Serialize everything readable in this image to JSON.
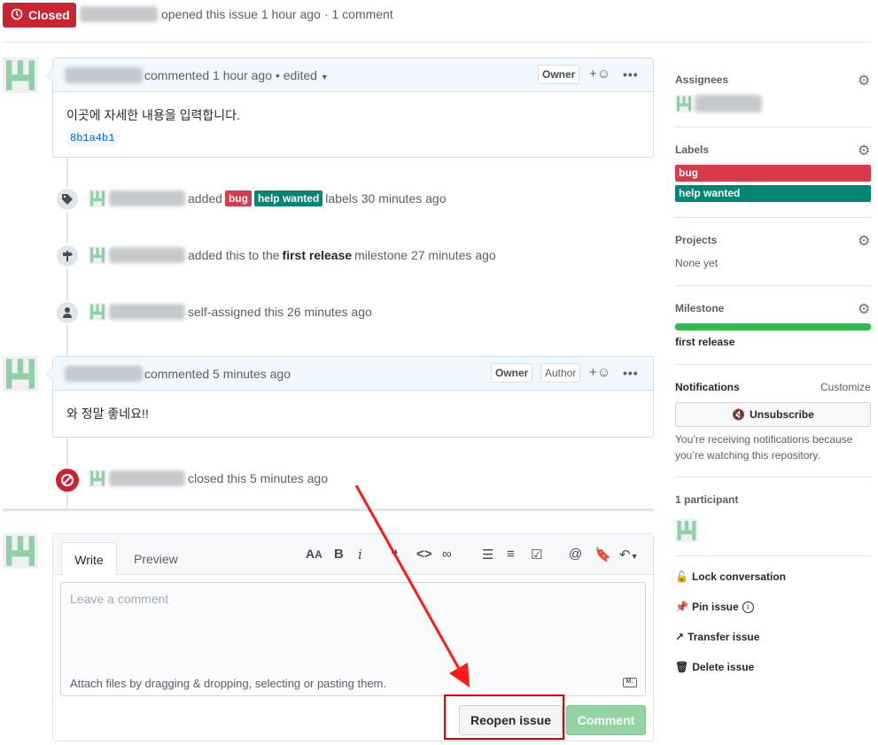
{
  "header": {
    "state": "Closed",
    "opened_text": "opened this issue 1 hour ago",
    "separator": "·",
    "comments_count": "1 comment"
  },
  "comments": [
    {
      "meta": "commented 1 hour ago",
      "edited": "• edited",
      "roles": [
        "Owner"
      ],
      "reaction_plus": "+",
      "more": "•••",
      "body": "이곳에 자세한 내용을 입력합니다.",
      "sha": "8b1a4b1"
    },
    {
      "meta": "commented 5 minutes ago",
      "roles": [
        "Owner",
        "Author"
      ],
      "reaction_plus": "+",
      "more": "•••",
      "body": "와 정말 좋네요!!"
    }
  ],
  "timeline": {
    "labels_event": {
      "added": "added",
      "label_bug": "bug",
      "label_help": "help wanted",
      "suffix": "labels 30 minutes ago"
    },
    "milestone_event": {
      "prefix": "added this to the",
      "milestone": "first release",
      "suffix": "milestone 27 minutes ago"
    },
    "assign_event": {
      "text": "self-assigned this 26 minutes ago"
    },
    "closed_event": {
      "text": "closed this 5 minutes ago"
    }
  },
  "editor": {
    "tab_write": "Write",
    "tab_preview": "Preview",
    "placeholder": "Leave a comment",
    "attach_hint": "Attach files by dragging & dropping, selecting or pasting them.",
    "reopen_button": "Reopen issue",
    "comment_button": "Comment",
    "toolbar_icons": [
      "text-size-icon",
      "bold-icon",
      "italic-icon",
      "quote-icon",
      "code-icon",
      "link-icon",
      "bulleted-list-icon",
      "numbered-list-icon",
      "task-list-icon",
      "mention-icon",
      "saved-reply-icon",
      "reply-icon"
    ]
  },
  "sidebar": {
    "assignees_title": "Assignees",
    "labels_title": "Labels",
    "labels": [
      {
        "name": "bug",
        "color": "#d73a4a"
      },
      {
        "name": "help wanted",
        "color": "#008672"
      }
    ],
    "projects_title": "Projects",
    "projects_value": "None yet",
    "milestone_title": "Milestone",
    "milestone_value": "first release",
    "milestone_progress": 1.0,
    "notifications_title": "Notifications",
    "customize": "Customize",
    "unsubscribe": "Unsubscribe",
    "notify_reason": "You’re receiving notifications because you’re watching this repository.",
    "participants": "1 participant",
    "actions": {
      "lock": "Lock conversation",
      "pin": "Pin issue",
      "transfer": "Transfer issue",
      "delete": "Delete issue"
    }
  },
  "colors": {
    "closed_red": "#cb2431",
    "green": "#2cbe4e",
    "comment_disabled": "#94d3a2",
    "annotation_red": "#ff0000"
  }
}
